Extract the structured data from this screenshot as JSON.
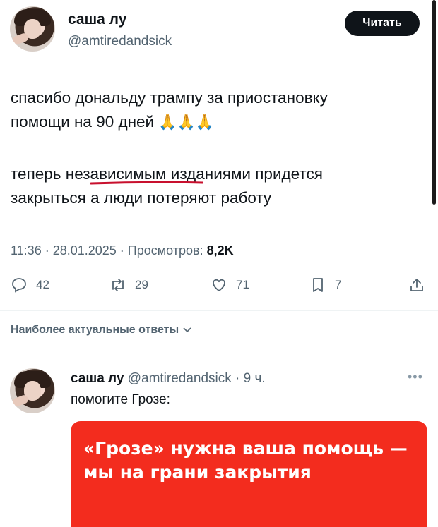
{
  "tweet": {
    "author_name": "саша лу",
    "author_handle": "@amtiredandsick",
    "follow_label": "Читать",
    "text_line1": "спасибо дональду трампу за приостановку",
    "text_line2_start": "помощи на 90 дней ",
    "text_line2_emoji": "🙏🙏🙏",
    "text_line3_before": "теперь ",
    "text_line3_highlight": "независимым",
    "text_line3_after": " изданиями придется",
    "text_line4": "закрыться а люди потеряют работу",
    "meta_time": "11:36 · 28.01.2025 · Просмотров: ",
    "meta_views": "8,2K",
    "underline_color": "#c8102e"
  },
  "actions": {
    "replies": "42",
    "reposts": "29",
    "likes": "71",
    "bookmarks": "7"
  },
  "sort": {
    "label": "Наиболее актуальные ответы"
  },
  "reply": {
    "author_name": "саша лу",
    "author_handle": "@amtiredandsick · 9 ч.",
    "text": "помогите Грозе:",
    "card_text": "«Грозе» нужна ваша помощь — мы на грани закрытия",
    "card_color": "#f32c1e"
  }
}
